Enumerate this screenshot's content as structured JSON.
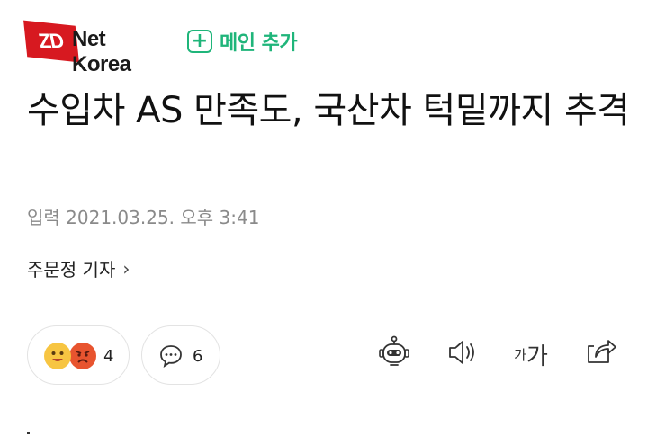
{
  "header": {
    "logo_mark": "ZD",
    "logo_name": "Net Korea",
    "add_main_plus": "+",
    "add_main_label": "메인 추가"
  },
  "article": {
    "title": "수입차 AS 만족도, 국산차 턱밑까지 추격",
    "date": "입력 2021.03.25. 오후 3:41",
    "reporter": "주문정 기자",
    "reporter_chevron": "›"
  },
  "actions": {
    "reaction_count": "4",
    "comment_count": "6",
    "font_size_small": "가",
    "font_size_large": "가"
  },
  "icons": {
    "reaction": [
      "smile-emoji-icon",
      "angry-emoji-icon"
    ],
    "comment": "speech-bubble-icon",
    "summary_bot": "robot-icon",
    "tts": "speaker-icon",
    "share": "share-icon"
  },
  "colors": {
    "brand_red": "#d71920",
    "accent_green": "#1fb57a",
    "meta_gray": "#8a8a8a"
  }
}
